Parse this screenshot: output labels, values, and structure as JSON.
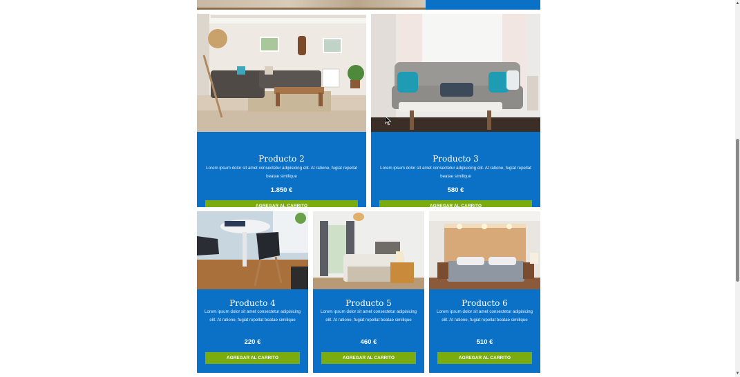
{
  "products": [
    {
      "name": "Producto 2",
      "description": "Lorem ipsum dolor sit amet consectetur adipisicing elit. At ratione, fugiat repellat beatae similique",
      "price": "1.850 €",
      "button_label": "AGREGAR AL CARRITO"
    },
    {
      "name": "Producto 3",
      "description": "Lorem ipsum dolor sit amet consectetur adipisicing elit. At ratione, fugiat repellat beatae similique",
      "price": "580 €",
      "button_label": "AGREGAR AL CARRITO"
    },
    {
      "name": "Producto 4",
      "description": "Lorem ipsum dolor sit amet consectetur adipisicing elit. At ratione, fugiat repellat beatae similique",
      "price": "220 €",
      "button_label": "AGREGAR AL CARRITO"
    },
    {
      "name": "Producto 5",
      "description": "Lorem ipsum dolor sit amet consectetur adipisicing elit. At ratione, fugiat repellat beatae similique",
      "price": "460 €",
      "button_label": "AGREGAR AL CARRITO"
    },
    {
      "name": "Producto 6",
      "description": "Lorem ipsum dolor sit amet consectetur adipisicing elit. At ratione, fugiat repellat beatae similique",
      "price": "510 €",
      "button_label": "AGREGAR AL CARRITO"
    }
  ],
  "icons": {
    "scroll_up": "triangle-up-icon",
    "scroll_down": "triangle-down-icon",
    "cursor": "mouse-pointer-icon"
  },
  "colors": {
    "card_blue": "#0a71c6",
    "button_green": "#7aac10",
    "text_white": "#ffffff"
  }
}
